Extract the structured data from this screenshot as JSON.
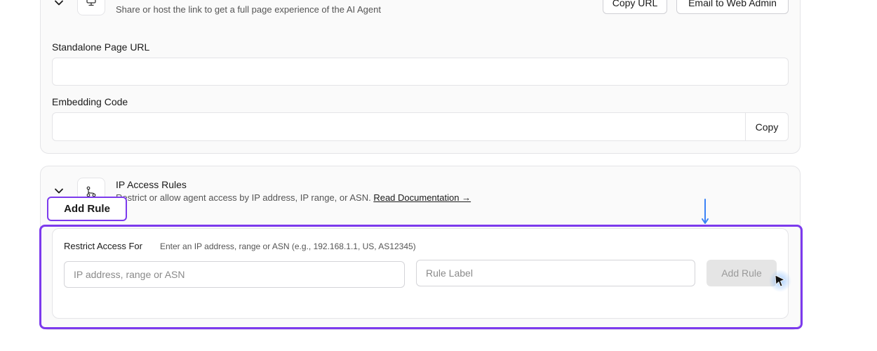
{
  "standalone": {
    "description": "Share or host the link to get a full page experience of the AI Agent",
    "copy_url_label": "Copy URL",
    "email_admin_label": "Email to Web Admin",
    "url_label": "Standalone Page URL",
    "url_value": "",
    "embed_label": "Embedding Code",
    "embed_value": "",
    "copy_label": "Copy"
  },
  "ip_rules": {
    "title": "IP Access Rules",
    "description": "Restrict or allow agent access by IP address, IP range, or ASN.",
    "doc_link": "Read Documentation →",
    "tooltip": "Add Rule",
    "restrict_title": "Restrict Access For",
    "restrict_help": "Enter an IP address, range or ASN (e.g., 192.168.1.1, US, AS12345)",
    "ip_placeholder": "IP address, range or ASN",
    "label_placeholder": "Rule Label",
    "add_button": "Add Rule"
  },
  "colors": {
    "highlight": "#7c3aed",
    "arrow": "#3b82f6",
    "disabled_button": "#e5e5e5"
  },
  "icons": {
    "collapse": "chevron-down-icon",
    "standalone": "monitor-icon",
    "ip_rules": "network-icon",
    "pointer": "cursor-icon",
    "indicator": "arrow-down-icon"
  }
}
